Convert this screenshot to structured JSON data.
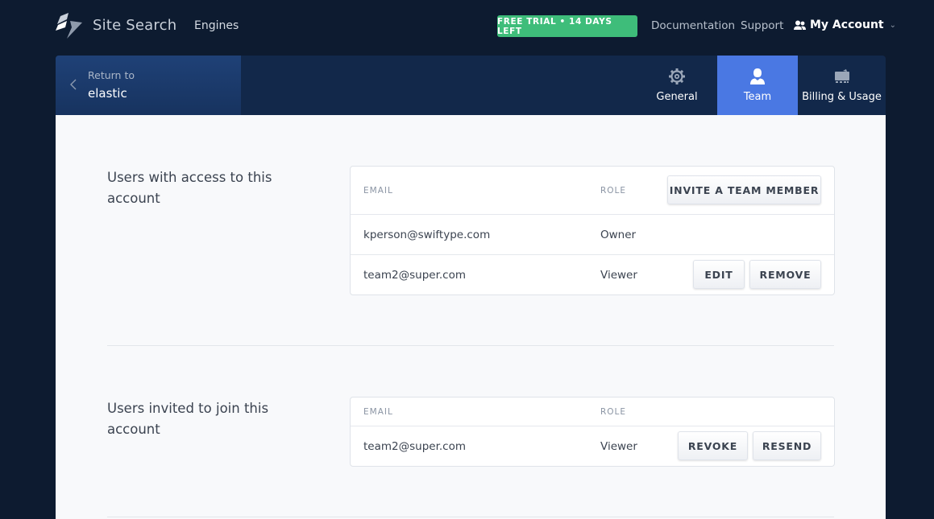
{
  "topbar": {
    "brand": "Site Search",
    "nav_engines": "Engines",
    "trial_badge": "FREE TRIAL • 14 DAYS LEFT",
    "documentation": "Documentation",
    "support": "Support",
    "account": "My Account"
  },
  "subnav": {
    "return_label": "Return to",
    "return_target": "elastic",
    "tabs": [
      {
        "label": "General",
        "icon": "gear-icon",
        "active": false
      },
      {
        "label": "Team",
        "icon": "user-icon",
        "active": true
      },
      {
        "label": "Billing & Usage",
        "icon": "billing-icon",
        "active": false
      }
    ]
  },
  "members": {
    "title": "Users with access to this account",
    "col_email": "EMAIL",
    "col_role": "ROLE",
    "invite_button": "INVITE A TEAM MEMBER",
    "rows": [
      {
        "email": "kperson@swiftype.com",
        "role": "Owner"
      },
      {
        "email": "team2@super.com",
        "role": "Viewer",
        "edit": "EDIT",
        "remove": "REMOVE"
      }
    ]
  },
  "invites": {
    "title": "Users invited to join this account",
    "col_email": "EMAIL",
    "col_role": "ROLE",
    "rows": [
      {
        "email": "team2@super.com",
        "role": "Viewer",
        "revoke": "REVOKE",
        "resend": "RESEND"
      }
    ]
  },
  "colors": {
    "background": "#0d1b30",
    "subnav": "#12284a",
    "active_tab": "#4a78e3",
    "trial_green": "#3ebd7a"
  }
}
